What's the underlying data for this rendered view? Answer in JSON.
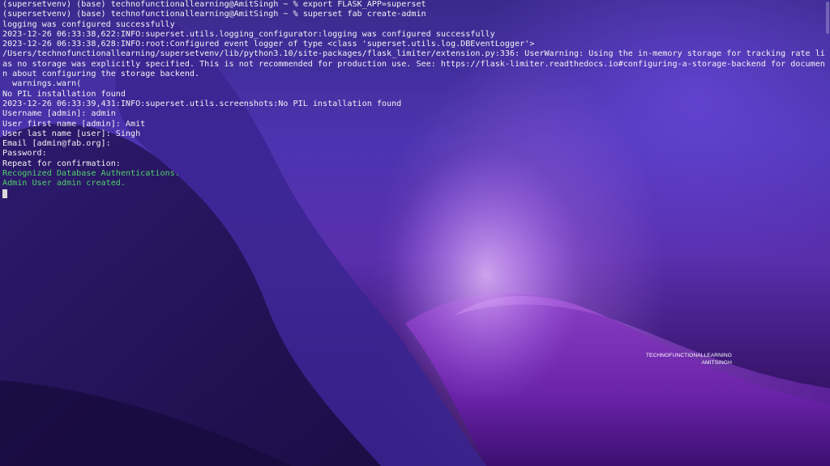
{
  "terminal": {
    "lines": [
      "(supersetvenv) (base) technofunctionallearning@AmitSingh ~ % export FLASK_APP=superset",
      "(supersetvenv) (base) technofunctionallearning@AmitSingh ~ % superset fab create-admin",
      "logging was configured successfully",
      "2023-12-26 06:33:38,622:INFO:superset.utils.logging_configurator:logging was configured successfully",
      "2023-12-26 06:33:38,628:INFO:root:Configured event logger of type <class 'superset.utils.log.DBEventLogger'>",
      "/Users/technofunctionallearning/supersetvenv/lib/python3.10/site-packages/flask_limiter/extension.py:336: UserWarning: Using the in-memory storage for tracking rate limits",
      "as no storage was explicitly specified. This is not recommended for production use. See: https://flask-limiter.readthedocs.io#configuring-a-storage-backend for documentatio",
      "n about configuring the storage backend.",
      "  warnings.warn(",
      "No PIL installation found",
      "2023-12-26 06:33:39,431:INFO:superset.utils.screenshots:No PIL installation found",
      "Username [admin]: admin",
      "User first name [admin]: Amit",
      "User last name [user]: Singh",
      "Email [admin@fab.org]:",
      "Password:",
      "Repeat for confirmation:",
      "Recognized Database Authentications.",
      "Admin User admin created."
    ],
    "colors": {
      "text": "#f2f2f2",
      "success": "#4fd16a"
    }
  },
  "watermark": {
    "line1": "TECHNOFUNCTIONALLEARNING",
    "line2": "AMITSINGH"
  }
}
